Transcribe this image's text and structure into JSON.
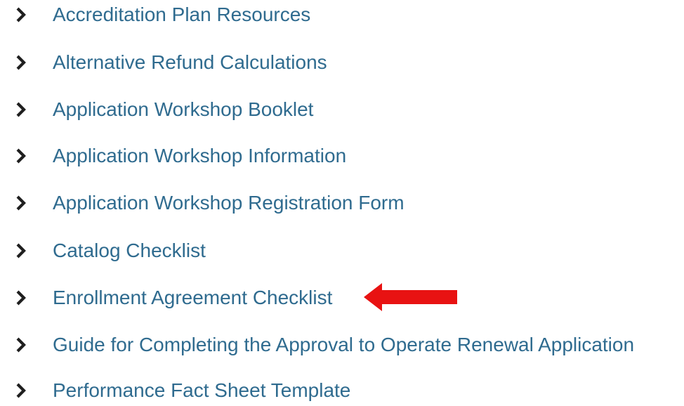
{
  "links": [
    {
      "label": "Accreditation Plan Resources"
    },
    {
      "label": "Alternative Refund Calculations"
    },
    {
      "label": "Application Workshop Booklet"
    },
    {
      "label": "Application Workshop Information"
    },
    {
      "label": "Application Workshop Registration Form"
    },
    {
      "label": "Catalog Checklist"
    },
    {
      "label": "Enrollment Agreement Checklist"
    },
    {
      "label": "Guide for Completing the Approval to Operate Renewal Application"
    },
    {
      "label": "Performance Fact Sheet Template"
    }
  ],
  "icons": {
    "bullet": "chevron-right-icon",
    "annotation": "red-arrow-left-icon"
  },
  "colors": {
    "link": "#2f6b8f",
    "chevron": "#1f1f1f",
    "annotation_arrow": "#e81212"
  }
}
